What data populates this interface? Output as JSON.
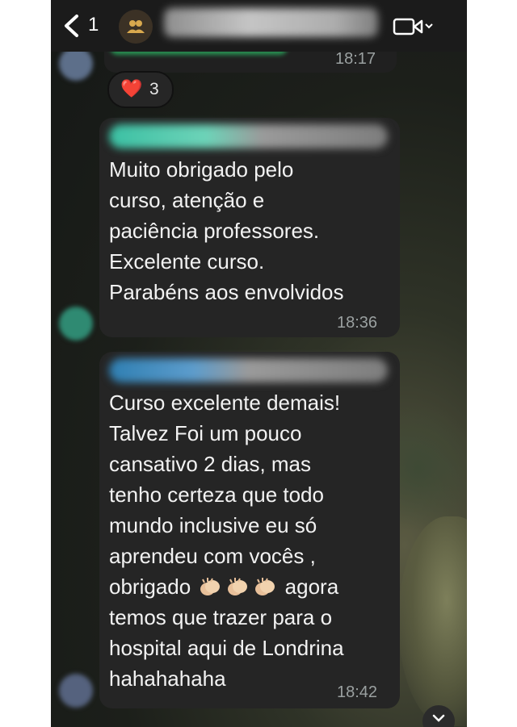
{
  "header": {
    "back_count": "1",
    "icons": {
      "back": "chevron-left-icon",
      "group": "group-icon",
      "video": "video-call-icon"
    }
  },
  "previous_message": {
    "time": "18:17",
    "reaction": {
      "emoji": "❤️",
      "count": "3"
    }
  },
  "messages": [
    {
      "text": "Muito obrigado pelo\ncurso, atenção e\npaciência professores.\nExcelente curso.\nParabéns aos envolvidos",
      "time": "18:36"
    },
    {
      "lines": [
        "Curso excelente demais!",
        "Talvez Foi um pouco",
        "cansativo 2 dias, mas",
        "tenho certeza que todo",
        "mundo inclusive eu só",
        "aprendeu com vocês ,"
      ],
      "line7_before": "obrigado",
      "line7_after": "agora",
      "lines_after": [
        "temos que trazer para o",
        "hospital aqui de Londrina",
        "hahahahaha"
      ],
      "emoji": "clapping-hands-icon",
      "time": "18:42"
    }
  ],
  "colors": {
    "bubble": "#252525",
    "header": "#1b1b1b",
    "reaction_heart": "#e7262c",
    "timestamp": "#9aa0a0"
  }
}
